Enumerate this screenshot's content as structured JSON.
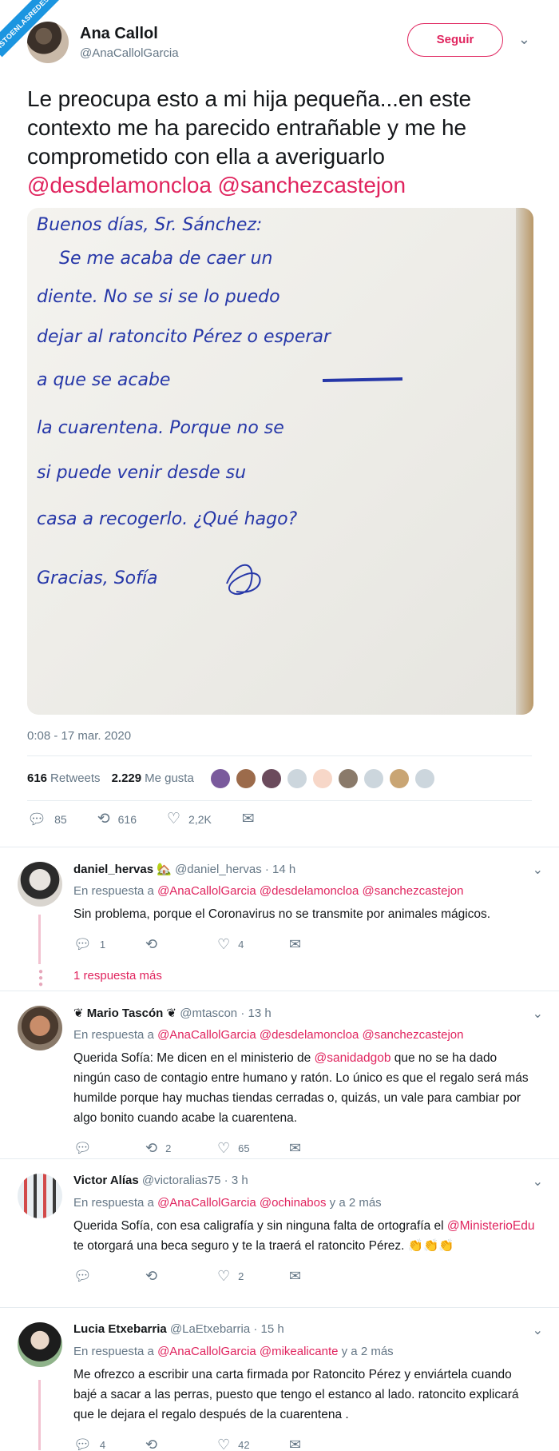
{
  "watermark": "VISTOENLASREDES.COM",
  "tweet": {
    "author_name": "Ana Callol",
    "author_handle": "@AnaCallolGarcia",
    "follow_label": "Seguir",
    "text_plain": "Le preocupa esto a mi hija pequeña...en este contexto me ha parecido entrañable y me he comprometido con ella a averiguarlo ",
    "mentions": [
      "@desdelamoncloa",
      "@sanchezcastejon"
    ],
    "timestamp": "0:08 - 17 mar. 2020",
    "retweets_count": "616",
    "retweets_label": "Retweets",
    "likes_count": "2.229",
    "likes_label": "Me gusta",
    "actions": {
      "replies": "85",
      "retweets": "616",
      "likes": "2,2K"
    },
    "letter": {
      "lines": [
        "Buenos días, Sr. Sánchez:",
        "Se    me    acaba    de    caer    un",
        "diente. No   se   si   se   lo   puedo",
        "dejar   al   ratoncito  Pérez   o   esperar",
        "a   que   se          acabe",
        "la   cuarentena. Porque   no   se",
        "si   puede   venir   desde   su",
        "casa   a   recogerlo. ¿Qué  hago?",
        "Gracias, Sofía"
      ]
    }
  },
  "replies": [
    {
      "name": "daniel_hervas 🏡",
      "handle": "@daniel_hervas",
      "time": "· 14 h",
      "reply_prefix": "En respuesta a",
      "reply_to": "@AnaCallolGarcia @desdelamoncloa @sanchezcastejon",
      "text": "Sin problema, porque el Coronavirus no se transmite por animales mágicos.",
      "replies": "1",
      "retweets": "",
      "likes": "4",
      "more": "1 respuesta más"
    },
    {
      "name": "❦ Mario Tascón ❦",
      "handle": "@mtascon",
      "time": "· 13 h",
      "reply_prefix": "En respuesta a",
      "reply_to": "@AnaCallolGarcia @desdelamoncloa @sanchezcastejon",
      "text_a": "Querida Sofía: Me dicen en el ministerio de ",
      "text_mention": "@sanidadgob",
      "text_b": " que no se ha dado ningún caso de contagio entre humano y ratón. Lo único es que el regalo será más humilde porque hay muchas tiendas cerradas o, quizás, un vale para cambiar por algo bonito cuando acabe la cuarentena.",
      "replies": "",
      "retweets": "2",
      "likes": "65"
    },
    {
      "name": "Victor Alías",
      "handle": "@victoralias75",
      "time": "· 3 h",
      "reply_prefix": "En respuesta a",
      "reply_to": "@AnaCallolGarcia @ochinabos",
      "reply_suffix": " y a 2 más",
      "text_a": "Querida Sofía, con esa caligrafía y sin ninguna falta de ortografía el ",
      "text_mention": "@MinisterioEdu",
      "text_b": " te otorgará una beca seguro y te la traerá el ratoncito Pérez. 👏👏👏",
      "replies": "",
      "retweets": "",
      "likes": "2"
    },
    {
      "name": "Lucia Etxebarria",
      "handle": "@LaEtxebarria",
      "time": "· 15 h",
      "reply_prefix": "En respuesta a",
      "reply_to": "@AnaCallolGarcia @mikealicante",
      "reply_suffix": " y a 2 más",
      "text": "Me ofrezco a escribir una carta firmada por Ratoncito Pérez y enviártela cuando bajé a sacar a las perras, puesto que tengo el estanco al lado. ratoncito explicará que le dejara el regalo después de la cuarentena .",
      "replies": "4",
      "retweets": "",
      "likes": "42"
    }
  ],
  "colors": {
    "accent": "#e0245e",
    "muted": "#657786",
    "text": "#14171a",
    "ink": "#2637a8"
  }
}
